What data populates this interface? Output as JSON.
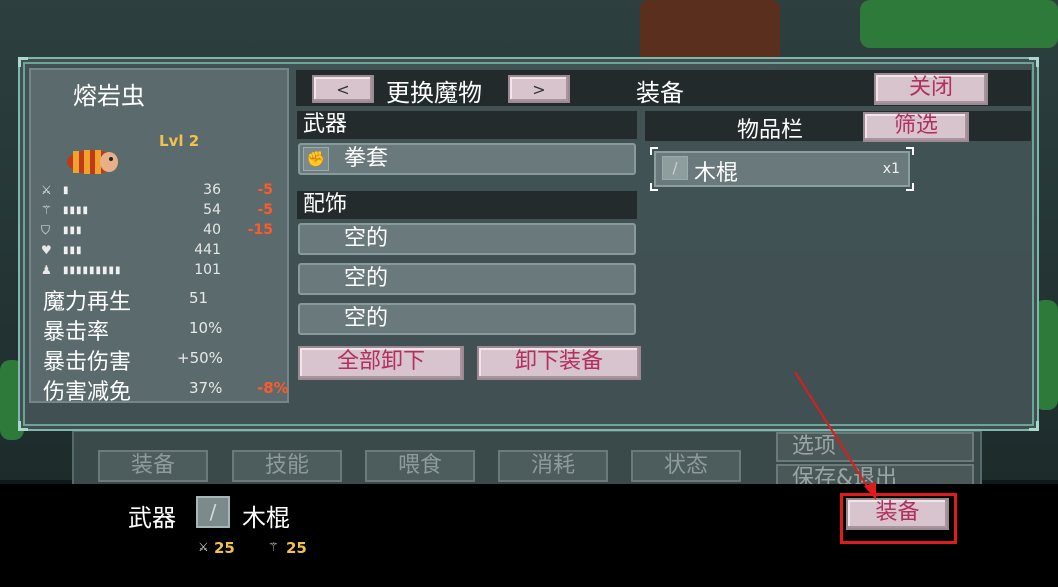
{
  "panel": {
    "monster_name": "熔岩虫",
    "level": "Lvl 2",
    "stats": [
      {
        "icon": "sword-icon",
        "bar": "▮",
        "value": "36",
        "mod": "-5"
      },
      {
        "icon": "staff-icon",
        "bar": "▮▮▮▮",
        "value": "54",
        "mod": "-5"
      },
      {
        "icon": "shield-icon",
        "bar": "▮▮▮",
        "value": "40",
        "mod": "-15"
      },
      {
        "icon": "heart-icon",
        "bar": "▮▮▮",
        "value": "441",
        "mod": ""
      },
      {
        "icon": "mana-icon",
        "bar": "▮▮▮▮▮▮▮▮▮",
        "value": "101",
        "mod": ""
      }
    ],
    "attributes": [
      {
        "label": "魔力再生",
        "value": "51",
        "mod": ""
      },
      {
        "label": "暴击率",
        "value": "10%",
        "mod": ""
      },
      {
        "label": "暴击伤害",
        "value": "+50%",
        "mod": ""
      },
      {
        "label": "伤害减免",
        "value": "37%",
        "mod": "-8%"
      }
    ]
  },
  "header": {
    "prev_label": "<",
    "switch_label": "更换魔物",
    "next_label": ">",
    "title": "装备",
    "close_label": "关闭"
  },
  "equipment": {
    "weapon_header": "武器",
    "weapon_slot": "拳套",
    "accessory_header": "配饰",
    "accessory_slots": [
      "空的",
      "空的",
      "空的"
    ],
    "unequip_all_label": "全部卸下",
    "unequip_label": "卸下装备"
  },
  "inventory": {
    "title": "物品栏",
    "filter_label": "筛选",
    "items": [
      {
        "name": "木棍",
        "count": "x1"
      }
    ]
  },
  "background": {
    "tabs": [
      "装备",
      "技能",
      "喂食",
      "消耗",
      "状态"
    ],
    "side_buttons": [
      "选项",
      "保存&退出"
    ]
  },
  "bottom": {
    "type_label": "武器",
    "item_name": "木棍",
    "stat1": "25",
    "stat2": "25",
    "equip_label": "装备"
  },
  "colors": {
    "accent_button_text": "#b1305c",
    "negative_mod": "#ff5a2a",
    "level": "#f2c24a",
    "highlight": "#e01b1b"
  }
}
